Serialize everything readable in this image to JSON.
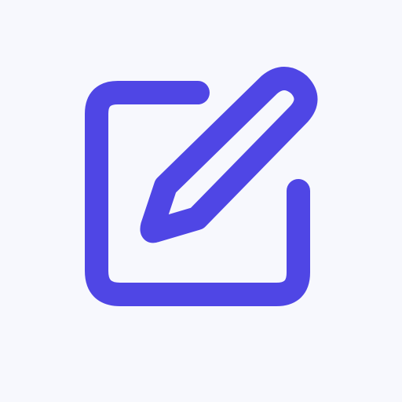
{
  "icon": {
    "name": "edit-icon",
    "accent_color": "#4f46e5",
    "background_color": "#f7f8fd"
  }
}
